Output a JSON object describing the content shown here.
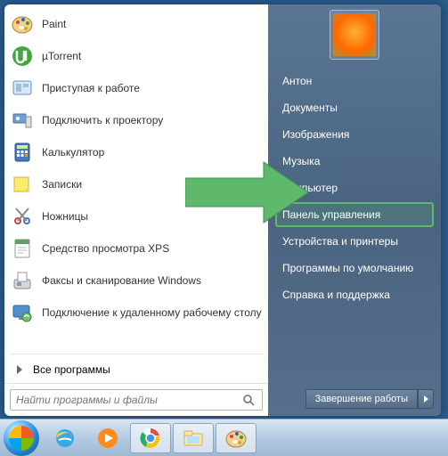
{
  "programs": [
    {
      "label": "Paint",
      "icon": "paint"
    },
    {
      "label": "µTorrent",
      "icon": "utorrent"
    },
    {
      "label": "Приступая к работе",
      "icon": "getting-started"
    },
    {
      "label": "Подключить к проектору",
      "icon": "projector"
    },
    {
      "label": "Калькулятор",
      "icon": "calculator"
    },
    {
      "label": "Записки",
      "icon": "sticky-notes"
    },
    {
      "label": "Ножницы",
      "icon": "snipping"
    },
    {
      "label": "Средство просмотра XPS",
      "icon": "xps"
    },
    {
      "label": "Факсы и сканирование Windows",
      "icon": "fax"
    },
    {
      "label": "Подключение к удаленному рабочему столу",
      "icon": "rdp"
    }
  ],
  "all_programs_label": "Все программы",
  "search_placeholder": "Найти программы и файлы",
  "right_items": [
    {
      "label": "Антон"
    },
    {
      "label": "Документы"
    },
    {
      "label": "Изображения"
    },
    {
      "label": "Музыка"
    },
    {
      "label": "Компьютер"
    },
    {
      "label": "Панель управления",
      "highlighted": true
    },
    {
      "label": "Устройства и принтеры"
    },
    {
      "label": "Программы по умолчанию"
    },
    {
      "label": "Справка и поддержка"
    }
  ],
  "shutdown_label": "Завершение работы",
  "taskbar": [
    {
      "icon": "ie",
      "active": false
    },
    {
      "icon": "wmp",
      "active": false
    },
    {
      "icon": "chrome",
      "active": true
    },
    {
      "icon": "explorer",
      "active": true
    },
    {
      "icon": "paint",
      "active": true
    }
  ],
  "colors": {
    "highlight_green": "#5eb96d"
  }
}
